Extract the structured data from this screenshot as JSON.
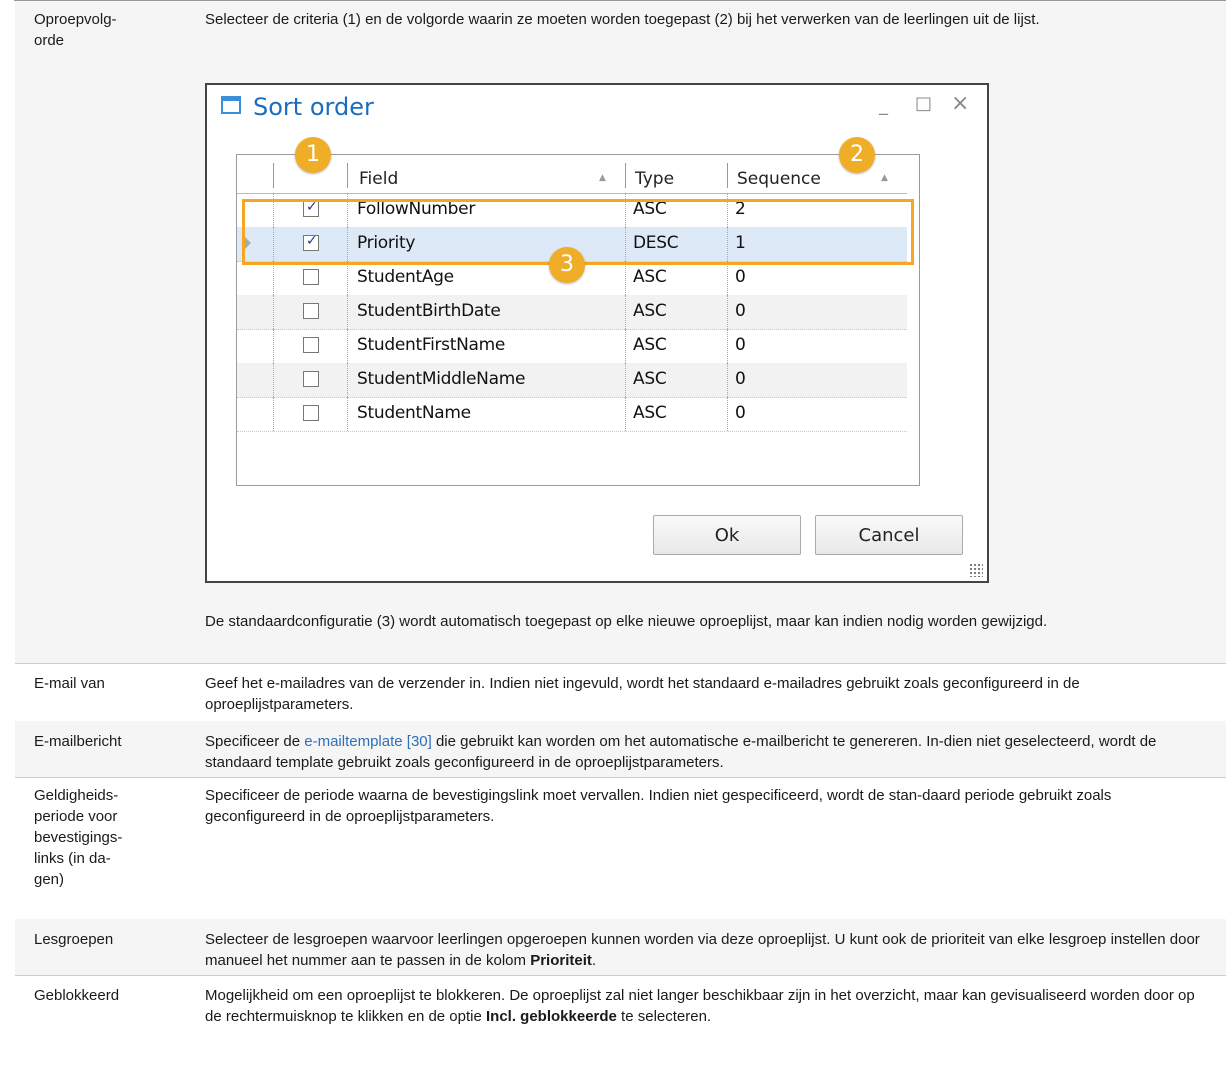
{
  "rows": [
    {
      "label": "Oproepvolg-\norde",
      "desc_top": "Selecteer de criteria (1) en de volgorde waarin ze moeten worden toegepast (2) bij het verwerken van de leerlingen uit de lijst.",
      "desc_bottom": "De standaardconfiguratie (3) wordt automatisch toegepast op elke nieuwe oproeplijst, maar kan indien nodig worden gewijzigd."
    },
    {
      "label": "E-mail van",
      "desc": "Geef het e-mailadres van de verzender in. Indien niet ingevuld, wordt het standaard e-mailadres gebruikt zoals geconfigureerd in de oproeplijstparameters."
    },
    {
      "label": "E-mailbericht",
      "desc_a": "Specificeer de ",
      "link": "e-mailtemplate [30]",
      "desc_b": " die gebruikt kan worden om het automatische e-mailbericht te genereren. In-dien niet geselecteerd, wordt de standaard template gebruikt zoals geconfigureerd in de oproeplijstparameters."
    },
    {
      "label": "Geldigheids-\nperiode voor\nbevestigings-\nlinks (in da-\ngen)",
      "desc": "Specificeer de periode waarna de bevestigingslink moet vervallen. Indien niet gespecificeerd, wordt de stan-daard periode gebruikt zoals geconfigureerd in de oproeplijstparameters."
    },
    {
      "label": "Lesgroepen",
      "desc_a": "Selecteer de lesgroepen waarvoor leerlingen opgeroepen kunnen worden via deze oproeplijst. U kunt ook de prioriteit van elke lesgroep instellen door manueel het nummer aan te passen in de kolom ",
      "bold": "Prioriteit",
      "desc_b": "."
    },
    {
      "label": "Geblokkeerd",
      "desc_a": "Mogelijkheid om een oproeplijst te blokkeren. De oproeplijst zal niet langer beschikbaar zijn in het overzicht, maar kan gevisualiseerd worden door op de rechtermuisknop te klikken en de optie ",
      "bold": "Incl. geblokkeerde",
      "desc_b": " te selecteren."
    }
  ],
  "dialog": {
    "title": "Sort order",
    "columns": [
      "Field",
      "Type",
      "Sequence"
    ],
    "grid_rows": [
      {
        "checked": true,
        "field": "FollowNumber",
        "type": "ASC",
        "sequence": "2"
      },
      {
        "checked": true,
        "field": "Priority",
        "type": "DESC",
        "sequence": "1"
      },
      {
        "checked": false,
        "field": "StudentAge",
        "type": "ASC",
        "sequence": "0"
      },
      {
        "checked": false,
        "field": "StudentBirthDate",
        "type": "ASC",
        "sequence": "0"
      },
      {
        "checked": false,
        "field": "StudentFirstName",
        "type": "ASC",
        "sequence": "0"
      },
      {
        "checked": false,
        "field": "StudentMiddleName",
        "type": "ASC",
        "sequence": "0"
      },
      {
        "checked": false,
        "field": "StudentName",
        "type": "ASC",
        "sequence": "0"
      }
    ],
    "ok_label": "Ok",
    "cancel_label": "Cancel",
    "minimize_glyph": "_",
    "maximize_glyph": "□",
    "close_glyph": "×",
    "check_glyph": "✓",
    "badges": [
      "1",
      "2",
      "3"
    ],
    "highlight_color": "#f5a623"
  }
}
